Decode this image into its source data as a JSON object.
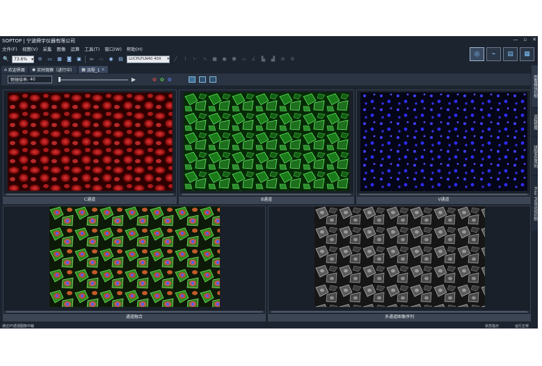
{
  "app": {
    "title": "SOPTOP | 宁波舜宇仪器有限公司"
  },
  "window_controls": [
    "—",
    "▫",
    "✕"
  ],
  "menu": [
    "文件(F)",
    "视图(V)",
    "采集",
    "图像",
    "运算",
    "工具(T)",
    "窗口(W)",
    "帮助(H)"
  ],
  "toolbar": {
    "zoom": "73.6%",
    "objective": "LUCPLFLN40 40X"
  },
  "tabs": [
    {
      "label": "欢迎界面"
    },
    {
      "label": "实时观察（进行中）"
    },
    {
      "label": "流程_1"
    }
  ],
  "controls": {
    "magnification_label": "物镜倍率:",
    "magnification_value": "40"
  },
  "side_tabs": [
    "图像模块控制",
    "流程管理",
    "拼图多层序列",
    "Prior PWB运动控制"
  ],
  "panels": [
    {
      "caption": "C通道"
    },
    {
      "caption": "B通道"
    },
    {
      "caption": "V通道"
    },
    {
      "caption": "通道融合"
    },
    {
      "caption": "多通道图像序列"
    }
  ],
  "status": {
    "left": "通过IFI透视图像中裁",
    "hint": "状态指示",
    "running": "运行正常"
  },
  "colors": {
    "accent": "#4a9fe0",
    "background": "#1c2430",
    "panel": "#1a2029"
  }
}
